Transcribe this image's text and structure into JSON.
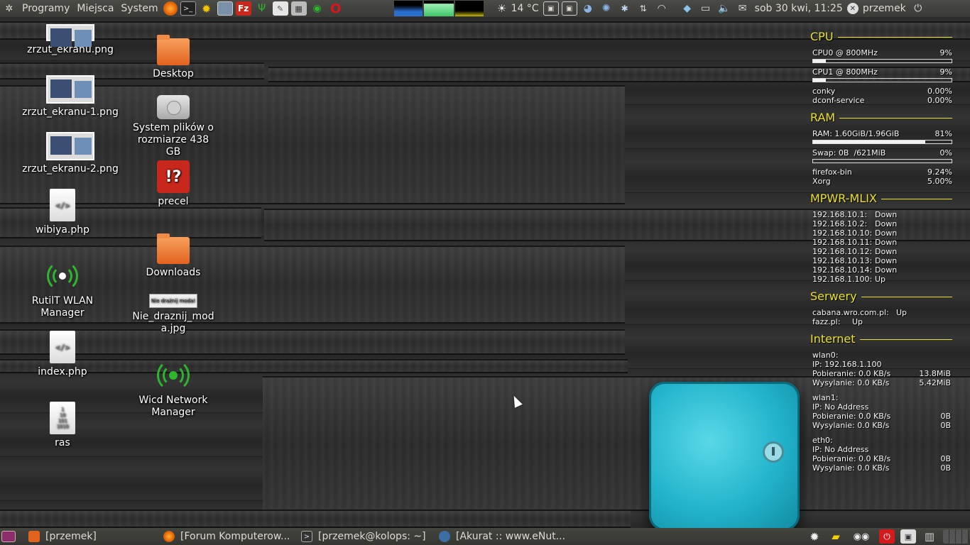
{
  "top_panel": {
    "menus": [
      "Programy",
      "Miejsca",
      "System"
    ],
    "weather": "14 °C",
    "datetime": "sob 30 kwi, 11:25",
    "user": "przemek"
  },
  "desktop": {
    "col1": [
      {
        "label": "zrzut_ekranu.png",
        "icon": "image-thumbnail-icon"
      },
      {
        "label": "zrzut_ekranu-1.png",
        "icon": "image-thumbnail-icon"
      },
      {
        "label": "zrzut_ekranu-2.png",
        "icon": "image-thumbnail-icon"
      },
      {
        "label": "wibiya.php",
        "icon": "php-file-icon",
        "glyph": "</>"
      },
      {
        "label": "RutilT WLAN Manager",
        "icon": "wlan-manager-icon"
      },
      {
        "label": "index.php",
        "icon": "php-file-icon",
        "glyph": "</>"
      },
      {
        "label": "ras",
        "icon": "binary-file-icon",
        "glyph": "1\n10\n101\n1010"
      }
    ],
    "col2": [
      {
        "label": "Desktop",
        "icon": "folder-icon"
      },
      {
        "label": "System plików o rozmiarze 438 GB",
        "icon": "hard-drive-icon"
      },
      {
        "label": "precel",
        "icon": "filezilla-icon"
      },
      {
        "label": "Downloads",
        "icon": "folder-icon"
      },
      {
        "label": "Nie_draznij_moda.jpg",
        "icon": "image-thumbnail-icon",
        "thumb_text": "Nie drażnij moda!"
      },
      {
        "label": "Wicd Network Manager",
        "icon": "wicd-icon"
      }
    ]
  },
  "conky": {
    "cpu": {
      "title": "CPU",
      "cores": [
        {
          "label": "CPU0 @ 800MHz",
          "value": "9%",
          "fill": 0.09
        },
        {
          "label": "CPU1 @ 800MHz",
          "value": "9%",
          "fill": 0.09
        }
      ],
      "processes": [
        {
          "name": "conky",
          "value": "0.00%"
        },
        {
          "name": "dconf-service",
          "value": "0.00%"
        }
      ]
    },
    "ram": {
      "title": "RAM",
      "ram_label": "RAM: 1.60GiB/1.96GiB",
      "ram_value": "81%",
      "ram_fill": 0.81,
      "swap_label": "Swap: 0B  /621MiB",
      "swap_value": "0%",
      "swap_fill": 0.0,
      "processes": [
        {
          "name": "firefox-bin",
          "value": "9.24%"
        },
        {
          "name": "Xorg",
          "value": "5.00%"
        }
      ]
    },
    "mpwr": {
      "title": "MPWR-MLIX",
      "hosts": [
        {
          "host": "192.168.10.1:",
          "status": "Down"
        },
        {
          "host": "192.168.10.2:",
          "status": "Down"
        },
        {
          "host": "192.168.10.10:",
          "status": "Down"
        },
        {
          "host": "192.168.10.11:",
          "status": "Down"
        },
        {
          "host": "192.168.10.12:",
          "status": "Down"
        },
        {
          "host": "192.168.10.13:",
          "status": "Down"
        },
        {
          "host": "192.168.10.14:",
          "status": "Down"
        },
        {
          "host": "192.168.1.100:",
          "status": "Up"
        }
      ]
    },
    "serwery": {
      "title": "Serwery",
      "hosts": [
        {
          "host": "cabana.wro.com.pl:",
          "status": "Up"
        },
        {
          "host": "fazz.pl:",
          "status": "Up"
        }
      ]
    },
    "internet": {
      "title": "Internet",
      "interfaces": [
        {
          "name": "wlan0:",
          "ip": "IP: 192.168.1.100",
          "down": "Pobieranie: 0.0 KB/s",
          "down_total": "13.8MiB",
          "up": "Wysylanie: 0.0 KB/s",
          "up_total": "5.42MiB"
        },
        {
          "name": "wlan1:",
          "ip": "IP: No Address",
          "down": "Pobieranie: 0.0 KB/s",
          "down_total": "0B",
          "up": "Wysylanie: 0.0 KB/s",
          "up_total": "0B"
        },
        {
          "name": "eth0:",
          "ip": "IP: No Address",
          "down": "Pobieranie: 0.0 KB/s",
          "down_total": "0B",
          "up": "Wysylanie: 0.0 KB/s",
          "up_total": "0B"
        }
      ]
    }
  },
  "taskbar": {
    "tasks": [
      {
        "label": "[przemek]",
        "icon": "folder-icon",
        "color": "#e2631f"
      },
      {
        "label": "[Forum Komputerow...",
        "icon": "firefox-icon",
        "color": "#e66000"
      },
      {
        "label": "[przemek@kolops: ~]",
        "icon": "terminal-icon",
        "color": "#333333"
      },
      {
        "label": "[Akurat :: www.eNut...",
        "icon": "thunderbird-icon",
        "color": "#3a6ea5"
      }
    ]
  }
}
